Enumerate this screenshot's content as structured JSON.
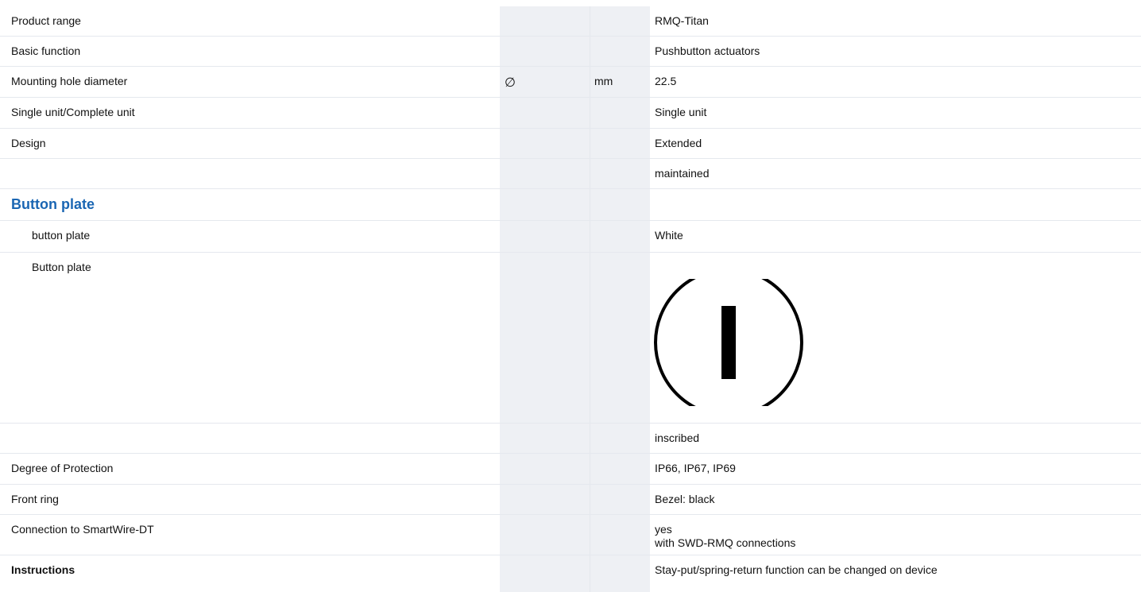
{
  "top_heading": "",
  "rows": [
    {
      "label": "Product range",
      "symbol": "",
      "unit": "",
      "value": "RMQ-Titan"
    },
    {
      "label": "Basic function",
      "symbol": "",
      "unit": "",
      "value": "Pushbutton actuators"
    },
    {
      "label": "Mounting hole diameter",
      "symbol": "∅",
      "unit": "mm",
      "value": "22.5"
    },
    {
      "label": "Single unit/Complete unit",
      "symbol": "",
      "unit": "",
      "value": "Single unit"
    },
    {
      "label": "Design",
      "symbol": "",
      "unit": "",
      "value": "Extended"
    },
    {
      "label": "",
      "symbol": "",
      "unit": "",
      "value": "maintained"
    }
  ],
  "section_title": "Button plate",
  "button_plate_color": {
    "label": "button plate",
    "value": "White"
  },
  "button_plate_image": {
    "label": "Button plate",
    "icon": "power-on-I-symbol-icon"
  },
  "rows2": [
    {
      "label": "",
      "value": "inscribed"
    },
    {
      "label": "Degree of Protection",
      "value": "IP66, IP67, IP69"
    },
    {
      "label": "Front ring",
      "value": "Bezel: black"
    },
    {
      "label": "Connection to SmartWire-DT",
      "value_line1": "yes",
      "value_line2": "with SWD-RMQ connections"
    },
    {
      "label": "Instructions",
      "value": "Stay-put/spring-return function can be changed on device"
    }
  ],
  "colors": {
    "accent": "#1a66b3",
    "shaded_column": "#eef0f4"
  }
}
